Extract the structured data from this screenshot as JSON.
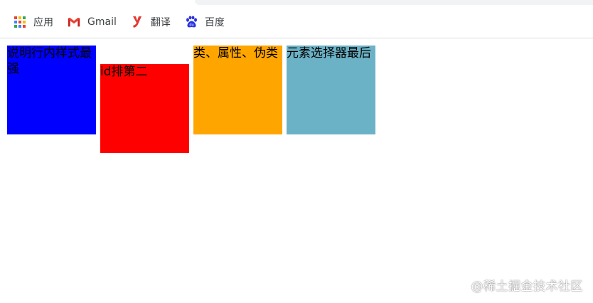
{
  "bookmarks": [
    {
      "label": "应用",
      "icon": "apps-grid-icon"
    },
    {
      "label": "Gmail",
      "icon": "gmail-icon"
    },
    {
      "label": "翻译",
      "icon": "youdao-icon"
    },
    {
      "label": "百度",
      "icon": "baidu-paw-icon"
    }
  ],
  "boxes": [
    {
      "text": "说明行内样式最强",
      "color": "#0000ff"
    },
    {
      "text": "id排第二",
      "color": "#ff0000"
    },
    {
      "text": "类、属性、伪类",
      "color": "#ffa500"
    },
    {
      "text": "元素选择器最后",
      "color": "#6bb2c6"
    }
  ],
  "watermark": "@稀土掘金技术社区"
}
